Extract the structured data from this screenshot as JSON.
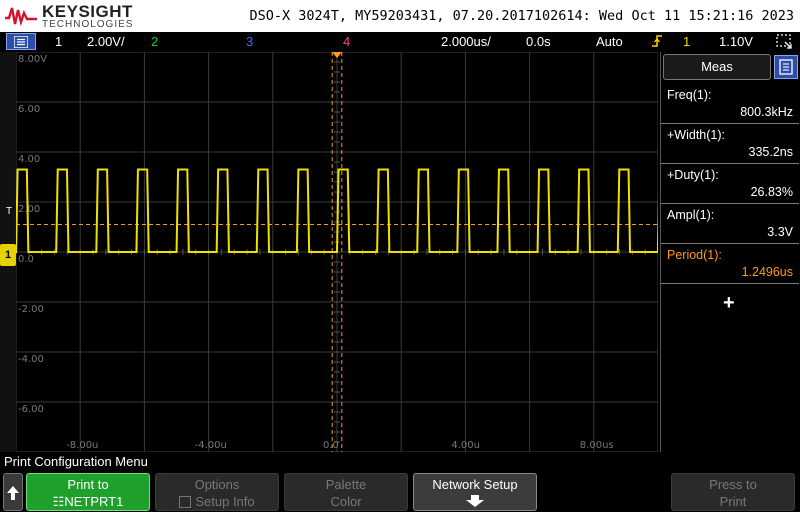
{
  "header": {
    "brand": "KEYSIGHT",
    "brand_sub": "TECHNOLOGIES",
    "info": "DSO-X 3024T, MY59203431, 07.20.2017102614: Wed Oct 11 15:21:16 2023"
  },
  "status": {
    "ch1_num": "1",
    "ch1_scale": "2.00V/",
    "ch2_num": "2",
    "ch3_num": "3",
    "ch4_num": "4",
    "timebase": "2.000us/",
    "delay": "0.0s",
    "trigger_mode": "Auto",
    "trigger_ch": "1",
    "trigger_level": "1.10V"
  },
  "axes": {
    "y_labels": [
      "8.00V",
      "6.00",
      "4.00",
      "2.00",
      "0.0",
      "-2.00",
      "-4.00",
      "-6.00"
    ],
    "x_labels": [
      "-8.00u",
      "-4.00u",
      "0.0",
      "4.00u",
      "8.00us"
    ]
  },
  "meas": {
    "tab_label": "Meas",
    "items": [
      {
        "label": "Freq(1):",
        "value": "800.3kHz"
      },
      {
        "label": "+Width(1):",
        "value": "335.2ns"
      },
      {
        "label": "+Duty(1):",
        "value": "26.83%"
      },
      {
        "label": "Ampl(1):",
        "value": "3.3V"
      },
      {
        "label": "Period(1):",
        "value": "1.2496us"
      }
    ],
    "add_label": "+"
  },
  "menu": {
    "title": "Print Configuration Menu",
    "print_to_l1": "Print to",
    "print_to_l2": "NETPRT1",
    "options_l1": "Options",
    "options_l2": "Setup Info",
    "palette_l1": "Palette",
    "palette_l2": "Color",
    "network_l1": "Network Setup",
    "press_l1": "Press to",
    "press_l2": "Print"
  },
  "colors": {
    "trace": "#f0e000",
    "cursor": "#ff9a1a",
    "ch2": "#1ec81e",
    "ch3": "#3d6cff",
    "ch4": "#ff3ca0"
  },
  "waveform": {
    "period_us": 1.2496,
    "high_time_us": 0.3352,
    "high_v": 3.3,
    "low_v": 0.0
  }
}
